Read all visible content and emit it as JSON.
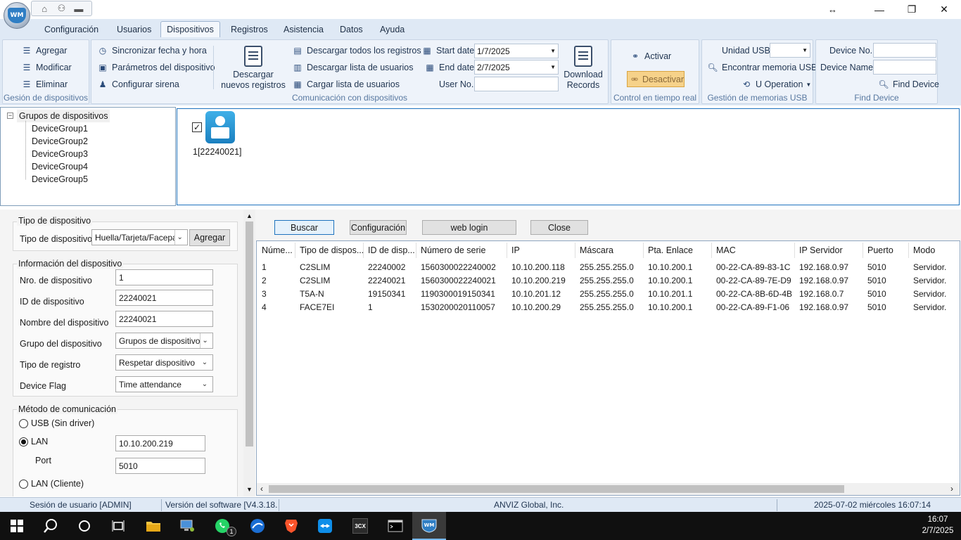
{
  "quickbar": {
    "icons": [
      "home-icon",
      "devices-icon",
      "dropdown-icon"
    ]
  },
  "window": {
    "minimize": "—",
    "maximize": "❐",
    "close": "✕",
    "resize_cursor": "↔"
  },
  "tabs": [
    {
      "label": "Configuración"
    },
    {
      "label": "Usuarios"
    },
    {
      "label": "Dispositivos",
      "active": true
    },
    {
      "label": "Registros"
    },
    {
      "label": "Asistencia"
    },
    {
      "label": "Datos"
    },
    {
      "label": "Ayuda"
    }
  ],
  "ribbon": {
    "gestion": {
      "label": "Gesión de dispositivos",
      "agregar": "Agregar",
      "modificar": "Modificar",
      "eliminar": "Eliminar"
    },
    "comunicacion": {
      "label": "Comunicación con dispositivos",
      "sync": "Sincronizar fecha y hora",
      "params": "Parámetros del dispositivo",
      "sirena": "Configurar sirena",
      "descargar_nuevos": "Descargar\nnuevos registros",
      "descargar_todos": "Descargar todos los registros",
      "descargar_lista": "Descargar lista de usuarios",
      "cargar_lista": "Cargar lista de usuarios",
      "start_date_label": "Start date",
      "start_date": "1/7/2025",
      "end_date_label": "End date",
      "end_date": "2/7/2025",
      "user_no_label": "User No.",
      "download_records": "Download\nRecords"
    },
    "control": {
      "label": "Control en tiempo real",
      "activar": "Activar",
      "desactivar": "Desactivar"
    },
    "usb": {
      "label": "Gestión de memorias USB",
      "unidad": "Unidad USB",
      "encontrar": "Encontrar memoria USB",
      "operation": "U Operation"
    },
    "find": {
      "label": "Find Device",
      "device_no": "Device No.",
      "device_name": "Device Name",
      "find": "Find Device"
    }
  },
  "tree": {
    "root": "Grupos de dispositivos",
    "groups": [
      "DeviceGroup1",
      "DeviceGroup2",
      "DeviceGroup3",
      "DeviceGroup4",
      "DeviceGroup5"
    ]
  },
  "device_tile": {
    "label": "1[22240021]",
    "checked": true
  },
  "form": {
    "tipo_legend": "Tipo de dispositivo",
    "tipo_label": "Tipo de dispositivo",
    "tipo_value": "Huella/Tarjeta/Facepa",
    "agregar_button": "Agregar",
    "info_legend": "Información del dispositivo",
    "nro_label": "Nro. de dispositivo",
    "nro_value": "1",
    "id_label": "ID de dispositivo",
    "id_value": "22240021",
    "nombre_label": "Nombre del dispositivo",
    "nombre_value": "22240021",
    "grupo_label": "Grupo del dispositivo",
    "grupo_value": "Grupos de dispositivo",
    "registro_label": "Tipo de registro",
    "registro_value": "Respetar dispositivo",
    "flag_label": "Device Flag",
    "flag_value": "Time attendance",
    "com_legend": "Método de comunicación",
    "usb_label": "USB (Sin driver)",
    "lan_label": "LAN",
    "lan_ip": "10.10.200.219",
    "port_label": "Port",
    "port_value": "5010",
    "lan_cliente_label": "LAN (Cliente)"
  },
  "buttons": {
    "buscar": "Buscar",
    "configuracion": "Configuración",
    "web_login": "web login",
    "close": "Close"
  },
  "grid": {
    "columns": [
      "Núme...",
      "Tipo de dispos...",
      "ID de disp...",
      "Número de serie",
      "IP",
      "Máscara",
      "Pta. Enlace",
      "MAC",
      "IP Servidor",
      "Puerto",
      "Modo"
    ],
    "rows": [
      [
        "1",
        "C2SLIM",
        "22240002",
        "1560300022240002",
        "10.10.200.118",
        "255.255.255.0",
        "10.10.200.1",
        "00-22-CA-89-83-1C",
        "192.168.0.97",
        "5010",
        "Servidor."
      ],
      [
        "2",
        "C2SLIM",
        "22240021",
        "1560300022240021",
        "10.10.200.219",
        "255.255.255.0",
        "10.10.200.1",
        "00-22-CA-89-7E-D9",
        "192.168.0.97",
        "5010",
        "Servidor."
      ],
      [
        "3",
        "T5A-N",
        "19150341",
        "1190300019150341",
        "10.10.201.12",
        "255.255.255.0",
        "10.10.201.1",
        "00-22-CA-8B-6D-4B",
        "192.168.0.7",
        "5010",
        "Servidor."
      ],
      [
        "4",
        "FACE7EI",
        "1",
        "1530200020110057",
        "10.10.200.29",
        "255.255.255.0",
        "10.10.200.1",
        "00-22-CA-89-F1-06",
        "192.168.0.97",
        "5010",
        "Servidor."
      ]
    ]
  },
  "status": {
    "session": "Sesión de usuario  [ADMIN]",
    "version": "Versión del software  [V4.3.18.(",
    "company": "ANVIZ Global, Inc.",
    "datetime": "2025-07-02 miércoles 16:07:14"
  },
  "taskbar": {
    "clock_time": "16:07",
    "clock_date": "2/7/2025",
    "whatsapp_badge": "1",
    "threecx": "3CX",
    "app_logo": "WM"
  },
  "colors": {
    "accent": "#1e73be",
    "ribbon_bg": "#dfe9f5",
    "desactivar_bg": "#f6d28a"
  }
}
